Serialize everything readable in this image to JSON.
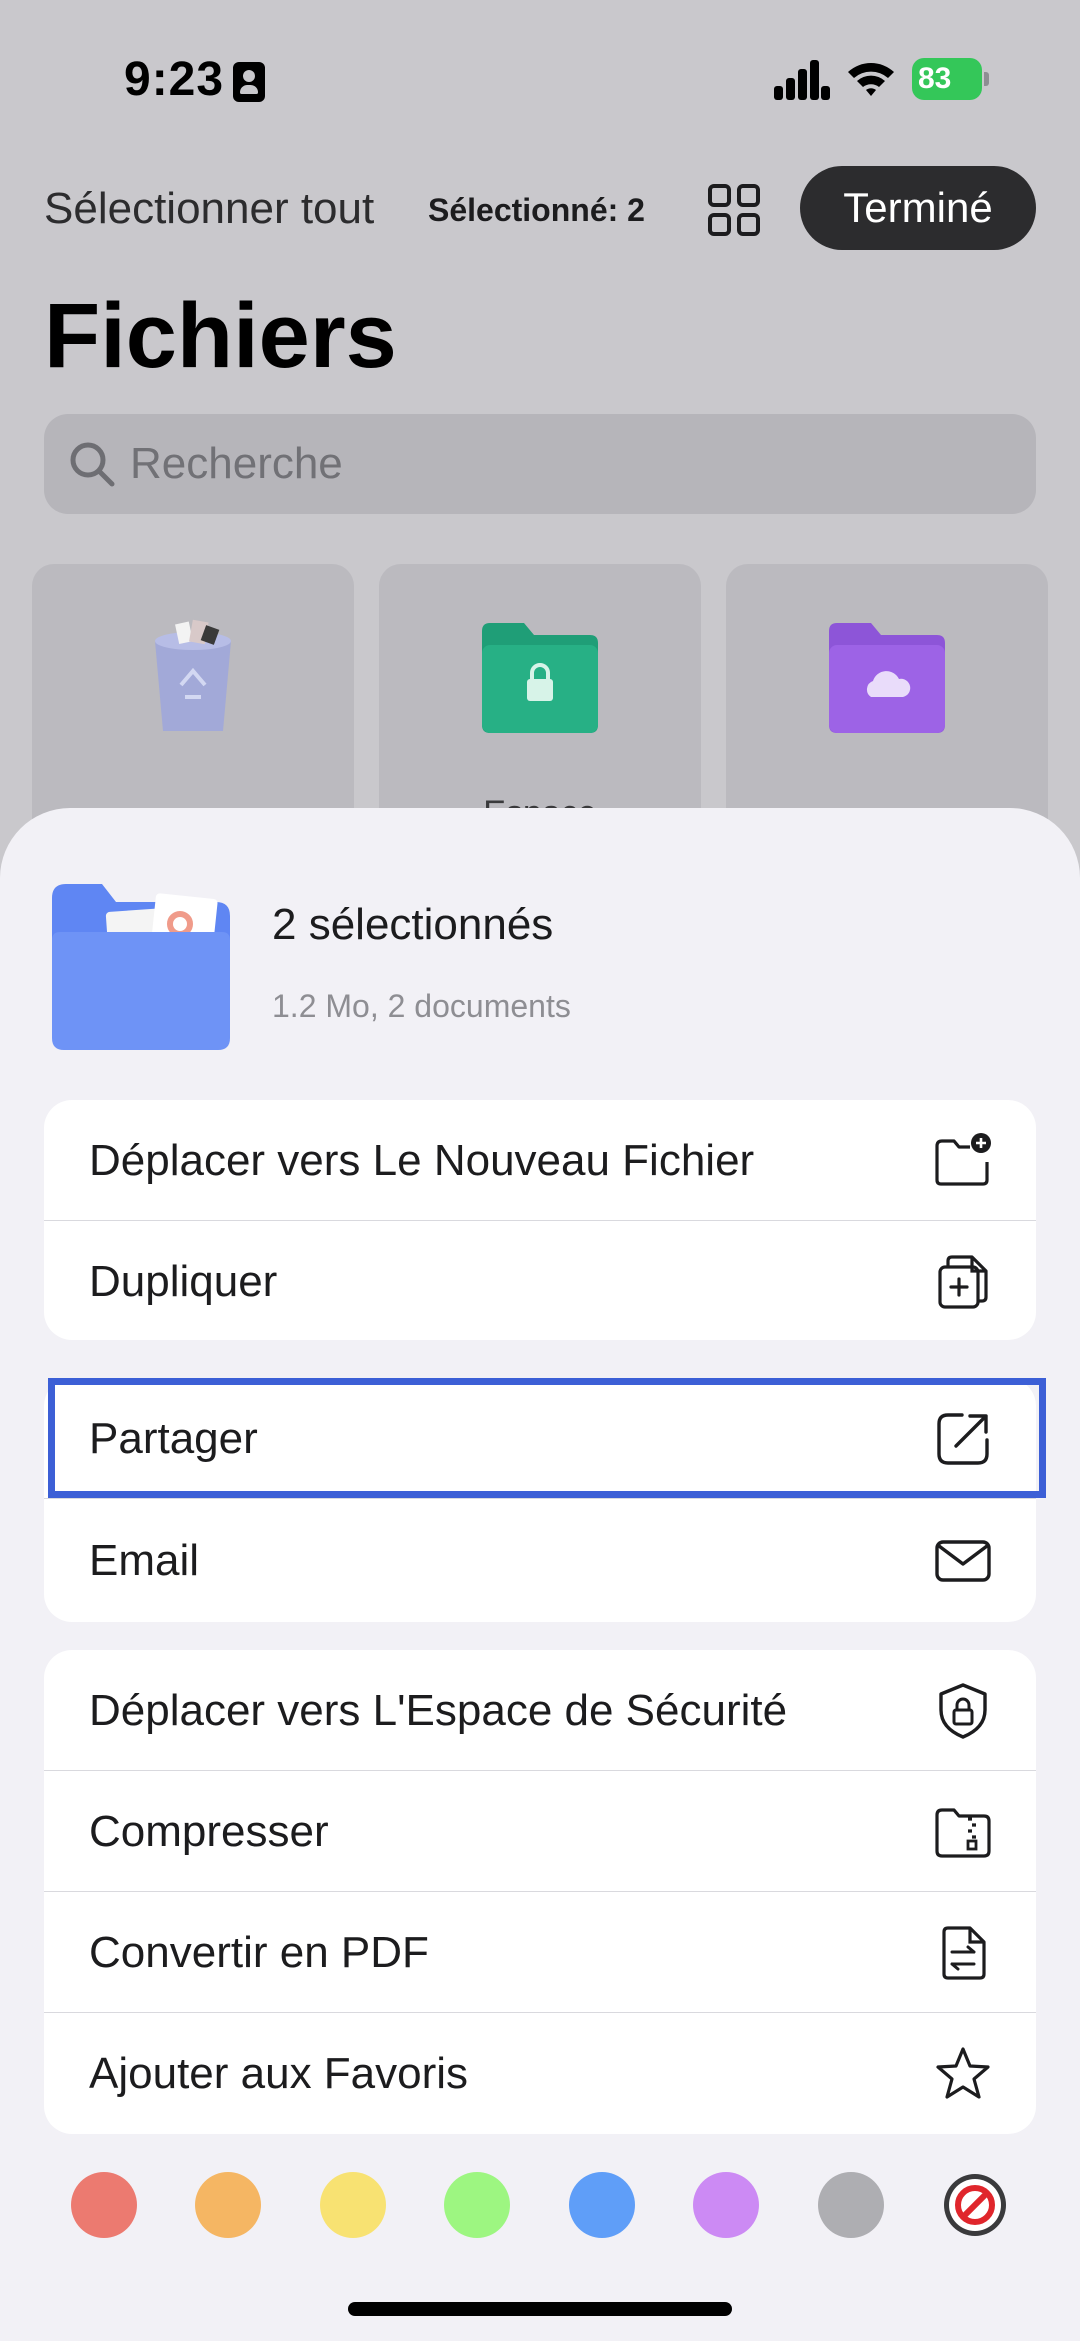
{
  "status_bar": {
    "time": "9:23",
    "battery": "83",
    "battery_color": "#34c759"
  },
  "nav": {
    "select_all": "Sélectionner tout",
    "selected_count": "Sélectionné: 2",
    "grid_icon": "grid-icon",
    "done": "Terminé"
  },
  "page_title": "Fichiers",
  "search": {
    "placeholder": "Recherche"
  },
  "tiles": [
    {
      "icon": "trash-icon",
      "label": ""
    },
    {
      "icon": "secure-folder-icon",
      "label": "Espace"
    },
    {
      "icon": "cloud-folder-icon",
      "label": ""
    }
  ],
  "sheet": {
    "title": "2 sélectionnés",
    "subtitle": "1.2 Mo, 2 documents",
    "groups": [
      [
        {
          "label": "Déplacer vers Le Nouveau Fichier",
          "icon": "new-folder-icon"
        },
        {
          "label": "Dupliquer",
          "icon": "duplicate-icon"
        }
      ],
      [
        {
          "label": "Partager",
          "icon": "share-icon",
          "highlighted": true
        },
        {
          "label": "Email",
          "icon": "mail-icon"
        }
      ],
      [
        {
          "label": "Déplacer vers L'Espace de Sécurité",
          "icon": "shield-lock-icon"
        },
        {
          "label": "Compresser",
          "icon": "zip-icon"
        },
        {
          "label": "Convertir en PDF",
          "icon": "convert-pdf-icon"
        },
        {
          "label": "Ajouter aux Favoris",
          "icon": "star-icon"
        }
      ]
    ],
    "highlight_color": "#3c5fd6"
  },
  "color_tags": [
    {
      "name": "red",
      "color": "#ec7a70"
    },
    {
      "name": "orange",
      "color": "#f5b663"
    },
    {
      "name": "yellow",
      "color": "#f8e272"
    },
    {
      "name": "green",
      "color": "#9df681"
    },
    {
      "name": "blue",
      "color": "#5f9ef8"
    },
    {
      "name": "purple",
      "color": "#cc8af4"
    },
    {
      "name": "gray",
      "color": "#aeaeb2"
    },
    {
      "name": "none",
      "icon": "no-tag-icon"
    }
  ]
}
